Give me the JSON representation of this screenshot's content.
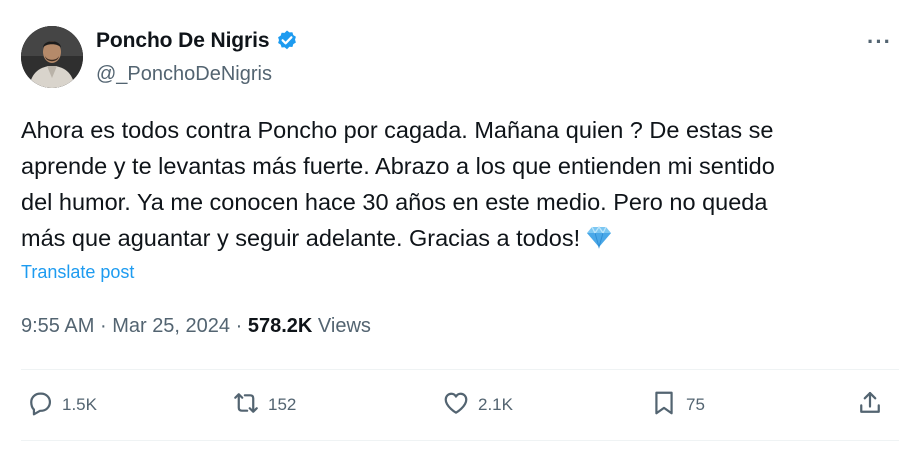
{
  "author": {
    "display_name": "Poncho De Nigris",
    "handle": "@_PonchoDeNigris",
    "verified": true
  },
  "tweet": {
    "lines": [
      "Ahora es todos contra Poncho por cagada. Mañana quien ? De estas se",
      "aprende y te levantas más fuerte. Abrazo a los que entienden mi sentido",
      "del humor. Ya me conocen hace 30 años en este medio. Pero no queda",
      "más que aguantar y seguir adelante. Gracias a todos!"
    ],
    "emoji": "gem-icon",
    "translate_label": "Translate post"
  },
  "meta": {
    "time": "9:55 AM",
    "separator": "·",
    "date": "Mar 25, 2024",
    "views_count": "578.2K",
    "views_label": "Views"
  },
  "actions": {
    "reply_count": "1.5K",
    "repost_count": "152",
    "like_count": "2.1K",
    "bookmark_count": "75"
  },
  "colors": {
    "accent": "#1d9bf0",
    "secondary_text": "#536471",
    "primary_text": "#0f1419",
    "divider": "#eff3f4"
  }
}
